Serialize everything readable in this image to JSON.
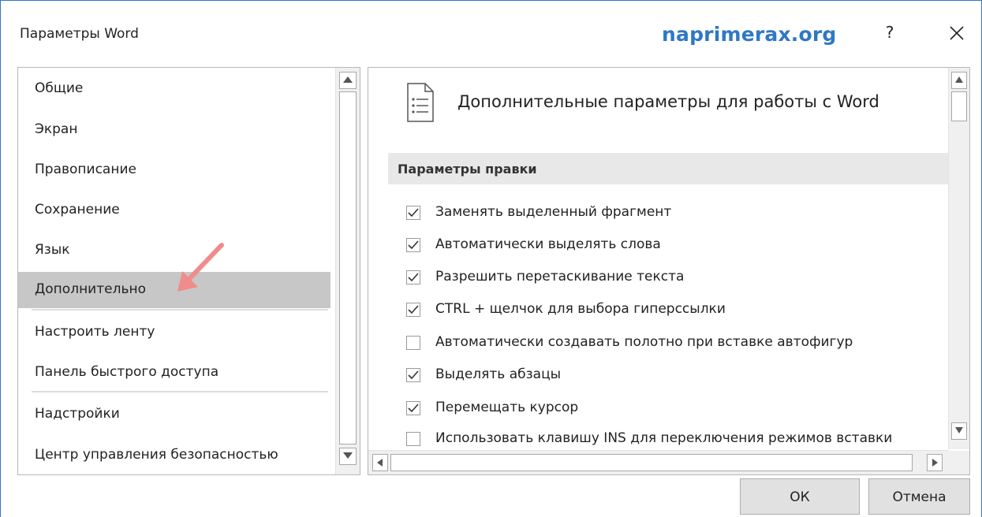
{
  "window": {
    "title": "Параметры Word",
    "watermark": "naprimerax.org",
    "help_label": "?"
  },
  "nav": {
    "items": [
      {
        "label": "Общие",
        "selected": false
      },
      {
        "label": "Экран",
        "selected": false
      },
      {
        "label": "Правописание",
        "selected": false
      },
      {
        "label": "Сохранение",
        "selected": false
      },
      {
        "label": "Язык",
        "selected": false
      },
      {
        "label": "Дополнительно",
        "selected": true
      },
      {
        "label": "Настроить ленту",
        "selected": false
      },
      {
        "label": "Панель быстрого доступа",
        "selected": false
      },
      {
        "label": "Надстройки",
        "selected": false
      },
      {
        "label": "Центр управления безопасностью",
        "selected": false
      }
    ]
  },
  "panel": {
    "heading": "Дополнительные параметры для работы с Word",
    "section_title": "Параметры правки",
    "options": [
      {
        "label": "Заменять выделенный фрагмент",
        "checked": true
      },
      {
        "label": "Автоматически выделять слова",
        "checked": true
      },
      {
        "label": "Разрешить перетаскивание текста",
        "checked": true
      },
      {
        "label": "CTRL + щелчок для выбора гиперссылки",
        "checked": true
      },
      {
        "label": "Автоматически создавать полотно при вставке автофигур",
        "checked": false
      },
      {
        "label": "Выделять абзацы",
        "checked": true
      },
      {
        "label": "Перемещать курсор",
        "checked": true
      },
      {
        "label": "Использовать клавишу INS для переключения режимов вставки",
        "checked": false
      }
    ]
  },
  "buttons": {
    "ok": "ОК",
    "cancel": "Отмена"
  },
  "colors": {
    "accent": "#2f78c4",
    "selected_bg": "#c7c7c7",
    "arrow": "#f08c8c"
  }
}
